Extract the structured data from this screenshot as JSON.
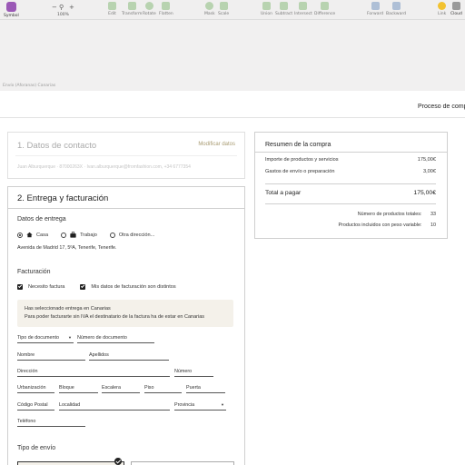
{
  "toolbar": {
    "symbol_label": "Symbol",
    "zoom_value": "100%",
    "zoom_minus": "−",
    "zoom_plus": "+",
    "items": {
      "edit": "Edit",
      "transform": "Transform",
      "rotate": "Rotate",
      "flatten": "Flatten",
      "mask": "Mask",
      "scale": "Scale",
      "union": "Union",
      "subtract": "Subtract",
      "intersect": "Intersect",
      "difference": "Difference",
      "forward": "Forward",
      "backward": "Backward",
      "link": "Link",
      "cloud": "Cloud"
    }
  },
  "canvas": {
    "frame_label": "Envío (Aforanas) Canarias"
  },
  "header": {
    "process_title": "Proceso de compra"
  },
  "contact": {
    "title": "1. Datos de contacto",
    "edit_link": "Modificar datos",
    "info": "Juan Alburquerque · 87000263X · Ivan.alburquerque@fromfashion.com, +34 6777354"
  },
  "delivery": {
    "title": "2. Entrega y facturación",
    "data_heading": "Datos de entrega",
    "options": [
      "Casa",
      "Trabajo",
      "Otra dirección..."
    ],
    "selected_option": "Casa",
    "address": "Avenida de Madrid 17, 5ºA, Tenerife, Tenerife.",
    "billing_heading": "Facturación",
    "checks": [
      "Necesito factura",
      "Mis datos de facturación son distintos"
    ],
    "notice_line1": "Has seleccionado entrega en Canarias",
    "notice_line2": "Para poder facturarte sin IVA el destinatario de la factura ha de estar en Canarias",
    "fields": {
      "doc_type": "Tipo de documento",
      "doc_number": "Número de documento",
      "name": "Nombre",
      "surname": "Apellidos",
      "address": "Dirección",
      "number": "Número",
      "urbanization": "Urbanización",
      "block": "Bloque",
      "stair": "Escalera",
      "floor": "Piso",
      "door": "Puerta",
      "postal_code": "Código Postal",
      "locality": "Localidad",
      "province": "Provincia",
      "phone": "Teléfono"
    },
    "shipping_heading": "Tipo de envío"
  },
  "summary": {
    "title": "Resumen de la compra",
    "products_label": "Importe de productos y servicios",
    "products_value": "175,00€",
    "shipping_label": "Gastos de envío o preparación",
    "shipping_value": "3,00€",
    "total_label": "Total a pagar",
    "total_value": "175,00€",
    "total_products_label": "Número de productos totales:",
    "total_products_value": "33",
    "variable_weight_label": "Productos incluidos con peso variable:",
    "variable_weight_value": "10"
  }
}
